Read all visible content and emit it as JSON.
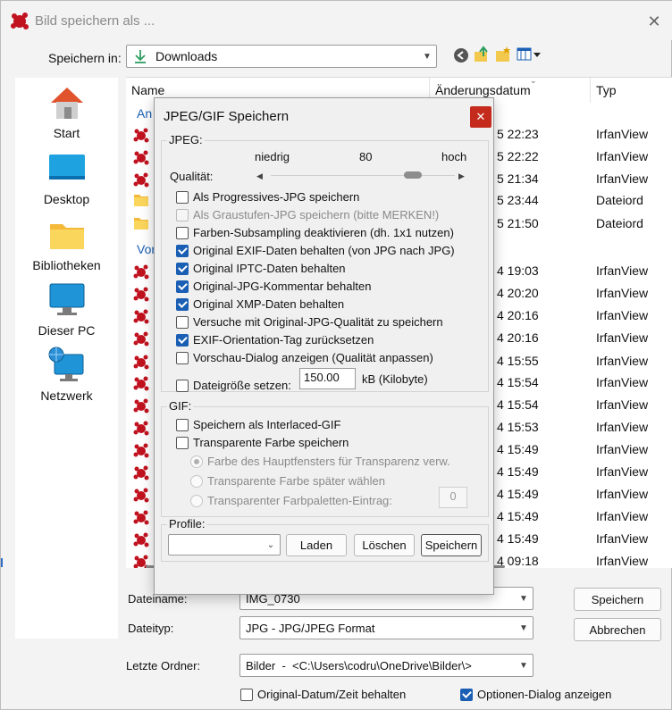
{
  "window": {
    "title": "Bild speichern als ..."
  },
  "toolbar": {
    "save_in_label": "Speichern in:",
    "save_in_value": "Downloads"
  },
  "places": [
    {
      "label": "Start",
      "icon": "home-icon"
    },
    {
      "label": "Desktop",
      "icon": "desktop-icon"
    },
    {
      "label": "Bibliotheken",
      "icon": "library-folder-icon"
    },
    {
      "label": "Dieser PC",
      "icon": "computer-icon"
    },
    {
      "label": "Netzwerk",
      "icon": "network-icon"
    }
  ],
  "filelist": {
    "columns": [
      "Name",
      "Änderungsdatum",
      "Typ"
    ],
    "group1": "An",
    "group2": "Vor",
    "rows": [
      {
        "time": "5 22:23",
        "type": "IrfanView",
        "icon": "irfanview-file-icon"
      },
      {
        "time": "5 22:22",
        "type": "IrfanView",
        "icon": "irfanview-file-icon"
      },
      {
        "time": "5 21:34",
        "type": "IrfanView",
        "icon": "irfanview-file-icon"
      },
      {
        "time": "5 23:44",
        "type": "Dateiord",
        "icon": "folder-icon"
      },
      {
        "time": "5 21:50",
        "type": "Dateiord",
        "icon": "folder-icon"
      },
      {
        "time": "4 19:03",
        "type": "IrfanView",
        "icon": "irfanview-file-icon"
      },
      {
        "time": "4 20:20",
        "type": "IrfanView",
        "icon": "irfanview-file-icon"
      },
      {
        "time": "4 20:16",
        "type": "IrfanView",
        "icon": "irfanview-file-icon"
      },
      {
        "time": "4 20:16",
        "type": "IrfanView",
        "icon": "irfanview-file-icon"
      },
      {
        "time": "4 15:55",
        "type": "IrfanView",
        "icon": "irfanview-file-icon"
      },
      {
        "time": "4 15:54",
        "type": "IrfanView",
        "icon": "irfanview-file-icon"
      },
      {
        "time": "4 15:54",
        "type": "IrfanView",
        "icon": "irfanview-file-icon"
      },
      {
        "time": "4 15:53",
        "type": "IrfanView",
        "icon": "irfanview-file-icon"
      },
      {
        "time": "4 15:49",
        "type": "IrfanView",
        "icon": "irfanview-file-icon"
      },
      {
        "time": "4 15:49",
        "type": "IrfanView",
        "icon": "irfanview-file-icon"
      },
      {
        "time": "4 15:49",
        "type": "IrfanView",
        "icon": "irfanview-file-icon"
      },
      {
        "time": "4 15:49",
        "type": "IrfanView",
        "icon": "irfanview-file-icon"
      },
      {
        "time": "4 15:49",
        "type": "IrfanView",
        "icon": "irfanview-file-icon"
      },
      {
        "time": "4 09:18",
        "type": "IrfanView",
        "icon": "irfanview-file-icon"
      }
    ]
  },
  "bottom": {
    "filename_label": "Dateiname:",
    "filename_value": "IMG_0730",
    "filetype_label": "Dateityp:",
    "filetype_value": "JPG - JPG/JPEG Format",
    "recent_label": "Letzte Ordner:",
    "recent_value": "Bilder  -  <C:\\Users\\codru\\OneDrive\\Bilder\\>",
    "save_button": "Speichern",
    "cancel_button": "Abbrechen",
    "keep_date_label": "Original-Datum/Zeit behalten",
    "keep_date_checked": false,
    "show_options_label": "Optionen-Dialog anzeigen",
    "show_options_checked": true
  },
  "jpeg_dialog": {
    "title": "JPEG/GIF Speichern",
    "jpeg_group": "JPEG:",
    "quality_low": "niedrig",
    "quality_value": "80",
    "quality_high": "hoch",
    "quality_label": "Qualität:",
    "quality_fraction": 0.8,
    "options": [
      {
        "label": "Als Progressives-JPG speichern",
        "checked": false,
        "disabled": false
      },
      {
        "label": "Als Graustufen-JPG speichern (bitte MERKEN!)",
        "checked": false,
        "disabled": true
      },
      {
        "label": "Farben-Subsampling deaktivieren (dh. 1x1 nutzen)",
        "checked": false,
        "disabled": false
      },
      {
        "label": "Original EXIF-Daten behalten (von JPG nach JPG)",
        "checked": true,
        "disabled": false
      },
      {
        "label": "Original IPTC-Daten behalten",
        "checked": true,
        "disabled": false
      },
      {
        "label": "Original-JPG-Kommentar behalten",
        "checked": true,
        "disabled": false
      },
      {
        "label": "Original XMP-Daten behalten",
        "checked": true,
        "disabled": false
      },
      {
        "label": "Versuche mit Original-JPG-Qualität zu speichern",
        "checked": false,
        "disabled": false
      },
      {
        "label": "EXIF-Orientation-Tag zurücksetzen",
        "checked": true,
        "disabled": false
      },
      {
        "label": "Vorschau-Dialog anzeigen (Qualität anpassen)",
        "checked": false,
        "disabled": false
      }
    ],
    "filesize_label": "Dateigröße setzen:",
    "filesize_value": "150.00",
    "filesize_unit": "kB (Kilobyte)",
    "gif_group": "GIF:",
    "gif_interlaced": "Speichern als Interlaced-GIF",
    "gif_transparent": "Transparente Farbe speichern",
    "radio1": "Farbe des Hauptfensters für Transparenz verw.",
    "radio2": "Transparente Farbe später wählen",
    "radio3": "Transparenter Farbpaletten-Eintrag:",
    "palette_index": "0",
    "profile_label": "Profile:",
    "profile_value": "",
    "load_button": "Laden",
    "delete_button": "Löschen",
    "save_button": "Speichern",
    "close_symbol": "✕"
  }
}
